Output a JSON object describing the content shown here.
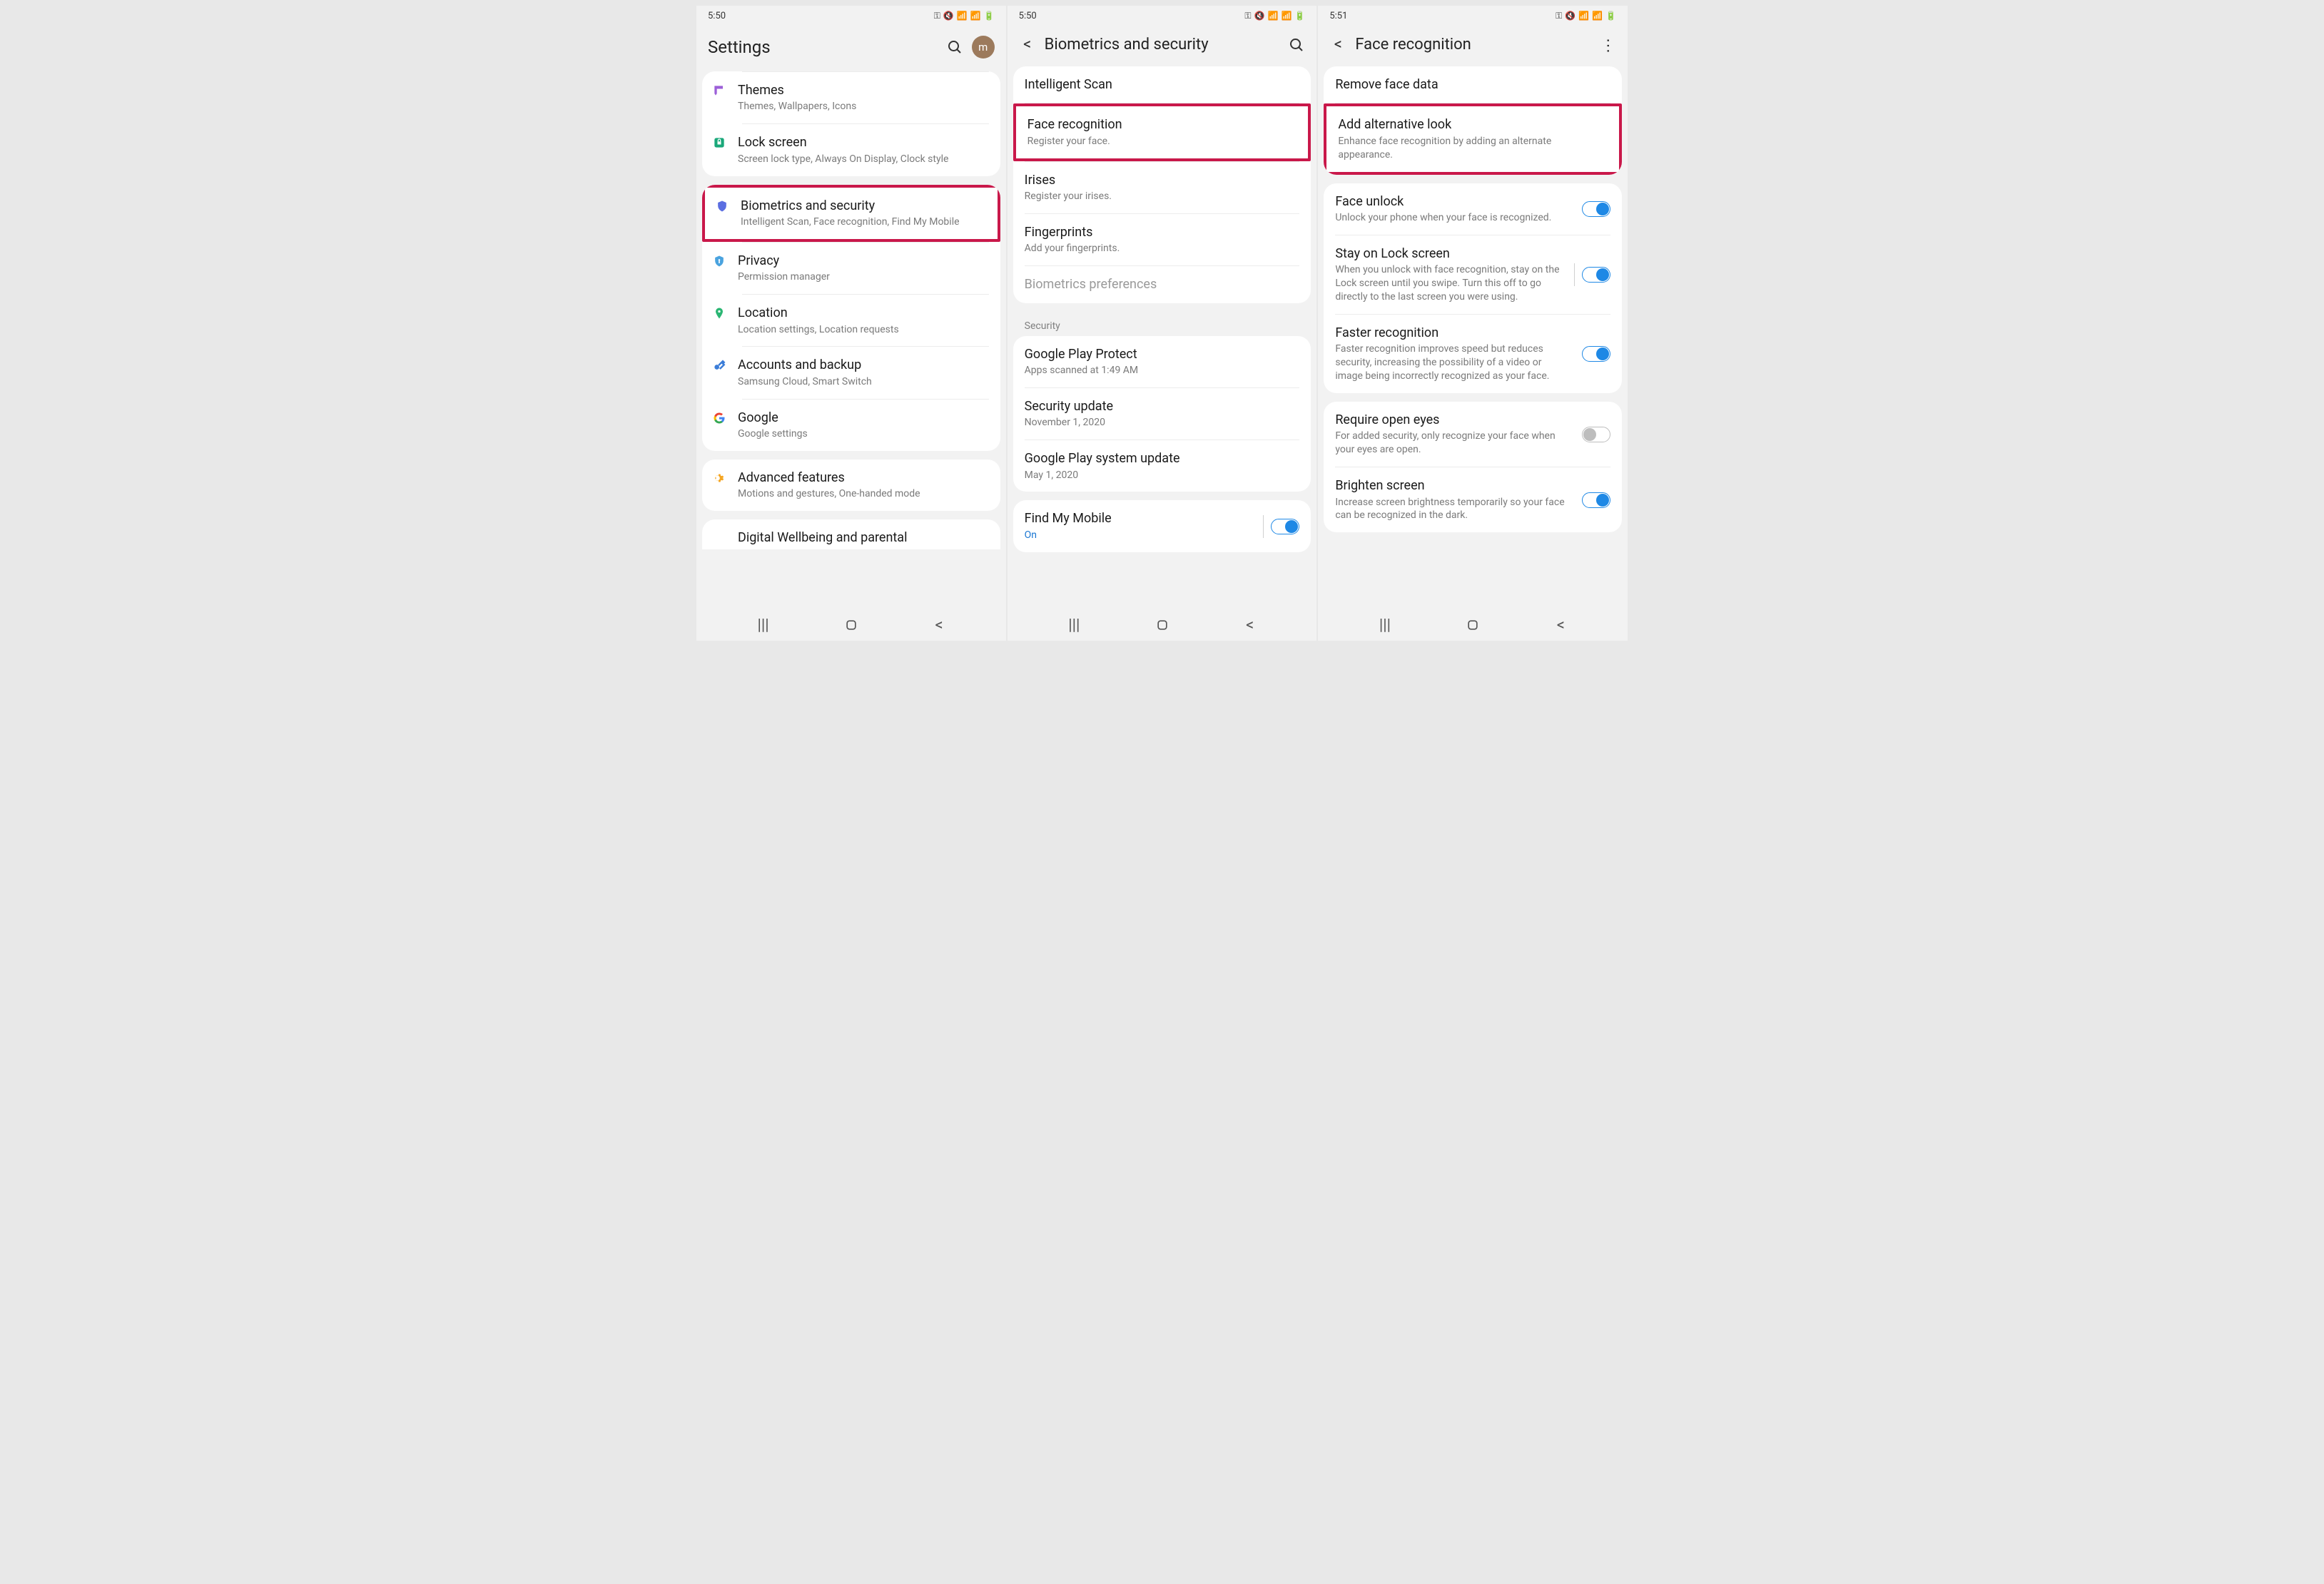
{
  "status": {
    "time1": "5:50",
    "time2": "5:50",
    "time3": "5:51"
  },
  "avatar_letter": "m",
  "screen1": {
    "title": "Settings",
    "items": {
      "themes": {
        "title": "Themes",
        "sub": "Themes, Wallpapers, Icons"
      },
      "lock": {
        "title": "Lock screen",
        "sub": "Screen lock type, Always On Display, Clock style"
      },
      "biometrics": {
        "title": "Biometrics and security",
        "sub": "Intelligent Scan, Face recognition, Find My Mobile"
      },
      "privacy": {
        "title": "Privacy",
        "sub": "Permission manager"
      },
      "location": {
        "title": "Location",
        "sub": "Location settings, Location requests"
      },
      "accounts": {
        "title": "Accounts and backup",
        "sub": "Samsung Cloud, Smart Switch"
      },
      "google": {
        "title": "Google",
        "sub": "Google settings"
      },
      "advanced": {
        "title": "Advanced features",
        "sub": "Motions and gestures, One-handed mode"
      },
      "wellbeing": {
        "title": "Digital Wellbeing and parental"
      }
    }
  },
  "screen2": {
    "title": "Biometrics and security",
    "section_security": "Security",
    "items": {
      "intscan": {
        "title": "Intelligent Scan"
      },
      "face": {
        "title": "Face recognition",
        "sub": "Register your face."
      },
      "irises": {
        "title": "Irises",
        "sub": "Register your irises."
      },
      "fingerprints": {
        "title": "Fingerprints",
        "sub": "Add your fingerprints."
      },
      "bioprefs": {
        "title": "Biometrics preferences"
      },
      "play_protect": {
        "title": "Google Play Protect",
        "sub": "Apps scanned at 1:49 AM"
      },
      "sec_update": {
        "title": "Security update",
        "sub": "November 1, 2020"
      },
      "play_update": {
        "title": "Google Play system update",
        "sub": "May 1, 2020"
      },
      "findmy": {
        "title": "Find My Mobile",
        "sub": "On"
      }
    }
  },
  "screen3": {
    "title": "Face recognition",
    "items": {
      "remove": {
        "title": "Remove face data"
      },
      "altlook": {
        "title": "Add alternative look",
        "sub": "Enhance face recognition by adding an alternate appearance."
      },
      "face_unlock": {
        "title": "Face unlock",
        "sub": "Unlock your phone when your face is recognized."
      },
      "stay": {
        "title": "Stay on Lock screen",
        "sub": "When you unlock with face recognition, stay on the Lock screen until you swipe. Turn this off to go directly to the last screen you were using."
      },
      "faster": {
        "title": "Faster recognition",
        "sub": "Faster recognition improves speed but reduces security, increasing the possibility of a video or image being incorrectly recognized as your face."
      },
      "eyes": {
        "title": "Require open eyes",
        "sub": "For added security, only recognize your face when your eyes are open."
      },
      "brighten": {
        "title": "Brighten screen",
        "sub": "Increase screen brightness temporarily so your face can be recognized in the dark."
      }
    }
  }
}
